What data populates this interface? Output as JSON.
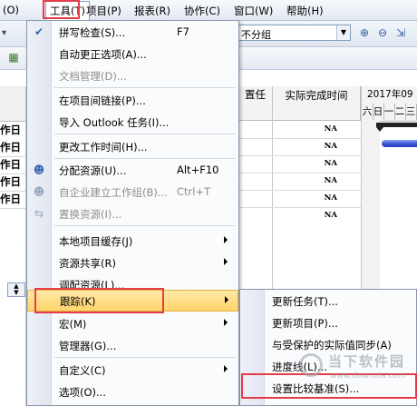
{
  "menubar": {
    "items": [
      {
        "label": "(O)"
      },
      {
        "label": "工具(T)"
      },
      {
        "label": "项目(P)"
      },
      {
        "label": "报表(R)"
      },
      {
        "label": "协作(C)"
      },
      {
        "label": "窗口(W)"
      },
      {
        "label": "帮助(H)"
      }
    ]
  },
  "toolbar": {
    "group_value": "不分组"
  },
  "left_grid": {
    "header": "作日",
    "rows": [
      "作日",
      "作日",
      "作日",
      "作日"
    ]
  },
  "grid": {
    "columns": [
      "置任",
      "实际完成时间"
    ],
    "na_values": [
      "NA",
      "NA",
      "NA",
      "NA",
      "NA",
      "NA"
    ]
  },
  "gantt": {
    "period": "2017年09月",
    "days": [
      "六",
      "日",
      "一",
      "二",
      "三"
    ]
  },
  "tools_menu": {
    "items": [
      {
        "label": "拼写检查(S)...",
        "shortcut": "F7",
        "icon": "spellcheck-icon",
        "enabled": true
      },
      {
        "label": "自动更正选项(A)...",
        "shortcut": "",
        "enabled": true
      },
      {
        "label": "文档管理(D)...",
        "shortcut": "",
        "enabled": false
      },
      {
        "label": "在项目间链接(P)...",
        "shortcut": "",
        "enabled": true
      },
      {
        "label": "导入 Outlook 任务(I)...",
        "shortcut": "",
        "enabled": true
      },
      {
        "label": "更改工作时间(H)...",
        "shortcut": "",
        "enabled": true
      },
      {
        "label": "分配资源(U)...",
        "shortcut": "Alt+F10",
        "icon": "assign-resources-icon",
        "enabled": true
      },
      {
        "label": "自企业建立工作组(B)...",
        "shortcut": "Ctrl+T",
        "icon": "build-team-icon",
        "enabled": false
      },
      {
        "label": "置换资源(I)...",
        "shortcut": "",
        "icon": "substitute-resources-icon",
        "enabled": false
      },
      {
        "label": "本地项目缓存(J)",
        "submenu": true,
        "enabled": true
      },
      {
        "label": "资源共享(R)",
        "submenu": true,
        "enabled": true
      },
      {
        "label": "调配资源(L)...",
        "enabled": true
      },
      {
        "label": "跟踪(K)",
        "submenu": true,
        "enabled": true,
        "highlighted": true
      },
      {
        "label": "宏(M)",
        "submenu": true,
        "enabled": true
      },
      {
        "label": "管理器(G)...",
        "enabled": true
      },
      {
        "label": "自定义(C)",
        "submenu": true,
        "enabled": true
      },
      {
        "label": "选项(O)...",
        "enabled": true
      }
    ]
  },
  "tracking_menu": {
    "items": [
      {
        "label": "更新任务(T)..."
      },
      {
        "label": "更新项目(P)..."
      },
      {
        "label": "与受保护的实际值同步(A)"
      },
      {
        "label": "进度线(L)..."
      },
      {
        "label": "设置比较基准(S)..."
      }
    ]
  },
  "watermark": {
    "brand": "当下软件园",
    "url": "www.downxia.com"
  },
  "colors": {
    "highlight_red": "#e43c48",
    "menu_hover": "#ffd46a",
    "gantt_bar": "#3150d8"
  }
}
